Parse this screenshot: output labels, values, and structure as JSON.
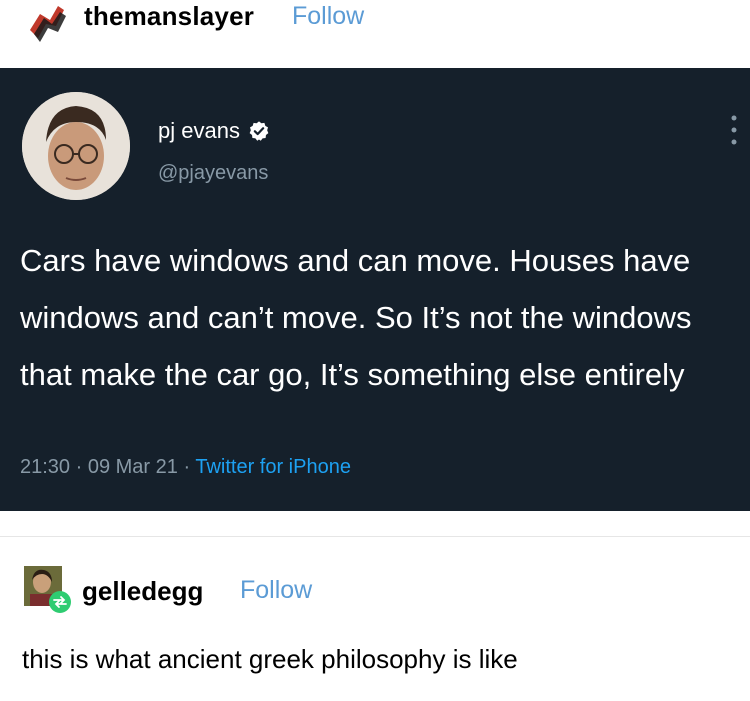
{
  "post": {
    "username": "themanslayer",
    "follow_label": "Follow"
  },
  "tweet": {
    "name": "pj evans",
    "handle": "@pjayevans",
    "text": "Cars have windows and can move. Houses have windows and can’t move. So It’s not the windows that make the car go, It’s something else entirely",
    "time": "21:30",
    "date": "09 Mar 21",
    "source": "Twitter for iPhone",
    "separator": " · "
  },
  "reblog": {
    "username": "gelledegg",
    "follow_label": "Follow",
    "text": "this is what ancient greek philosophy is like"
  },
  "colors": {
    "tweet_background": "#15202b",
    "follow_blue": "#5b9bd5",
    "twitter_blue": "#1da1f2",
    "muted_gray": "#8899a6"
  },
  "icons": {
    "verified": "verified-badge-icon",
    "more": "more-vertical-icon",
    "reblog": "reblog-icon"
  }
}
